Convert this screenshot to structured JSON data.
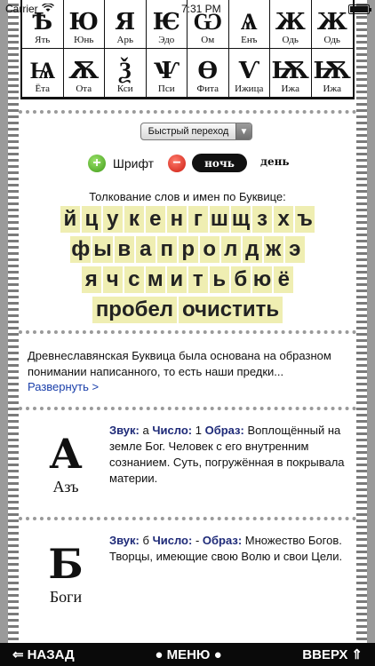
{
  "status": {
    "carrier": "Carrier",
    "time": "7:31 PM"
  },
  "alphabet": [
    {
      "glyph": "Ѣ",
      "name": "Ять"
    },
    {
      "glyph": "Ю",
      "name": "Юнь"
    },
    {
      "glyph": "Я",
      "name": "Арь"
    },
    {
      "glyph": "Ѥ",
      "name": "Эдо"
    },
    {
      "glyph": "Ѡ",
      "name": "Ом"
    },
    {
      "glyph": "Ѧ",
      "name": "Енъ"
    },
    {
      "glyph": "Ж",
      "name": "Одь"
    },
    {
      "glyph": "Ж",
      "name": "Одь"
    },
    {
      "glyph": "Ѩ",
      "name": "Ёта"
    },
    {
      "glyph": "Ѫ",
      "name": "Ота"
    },
    {
      "glyph": "Ѯ",
      "name": "Кси"
    },
    {
      "glyph": "Ѱ",
      "name": "Пси"
    },
    {
      "glyph": "Ѳ",
      "name": "Фита"
    },
    {
      "glyph": "Ѵ",
      "name": "Ижица"
    },
    {
      "glyph": "Ѭ",
      "name": "Ижа"
    },
    {
      "glyph": "Ѭ",
      "name": "Ижа"
    }
  ],
  "controls": {
    "quick_jump": "Быстрый переход",
    "font_label": "Шрифт",
    "night_label": "ночь",
    "day_label": "день",
    "interp_label": "Толкование слов и имен по Буквице:"
  },
  "keyboard": {
    "row1": [
      "й",
      "ц",
      "у",
      "к",
      "е",
      "н",
      "г",
      "ш",
      "щ",
      "з",
      "х",
      "ъ"
    ],
    "row2": [
      "ф",
      "ы",
      "в",
      "а",
      "п",
      "р",
      "о",
      "л",
      "д",
      "ж",
      "э"
    ],
    "row3": [
      "я",
      "ч",
      "с",
      "м",
      "и",
      "т",
      "ь",
      "б",
      "ю",
      "ё"
    ],
    "space_label": "пробел",
    "clear_label": "очистить"
  },
  "intro": {
    "text": "Древнеславянская Буквица была основана на образном понимании написанного, то есть наши предки...",
    "expand_label": "Развернуть >"
  },
  "letters": [
    {
      "glyph": "А",
      "name": "Азъ",
      "sound_label": "Звук:",
      "sound": "а",
      "number_label": "Число:",
      "number": "1",
      "image_label": "Образ:",
      "meaning": "Воплощённый на земле Бог. Человек с его внутренним сознанием. Суть, погружённая в покрывала материи."
    },
    {
      "glyph": "Б",
      "name": "Боги",
      "sound_label": "Звук:",
      "sound": "б",
      "number_label": "Число:",
      "number": "-",
      "image_label": "Образ:",
      "meaning": "Множество Богов. Творцы, имеющие свою Волю и свои Цели."
    }
  ],
  "bottom_bar": {
    "back_label": "НАЗАД",
    "menu_label": "● МЕНЮ ●",
    "up_label": "ВВЕРХ"
  }
}
